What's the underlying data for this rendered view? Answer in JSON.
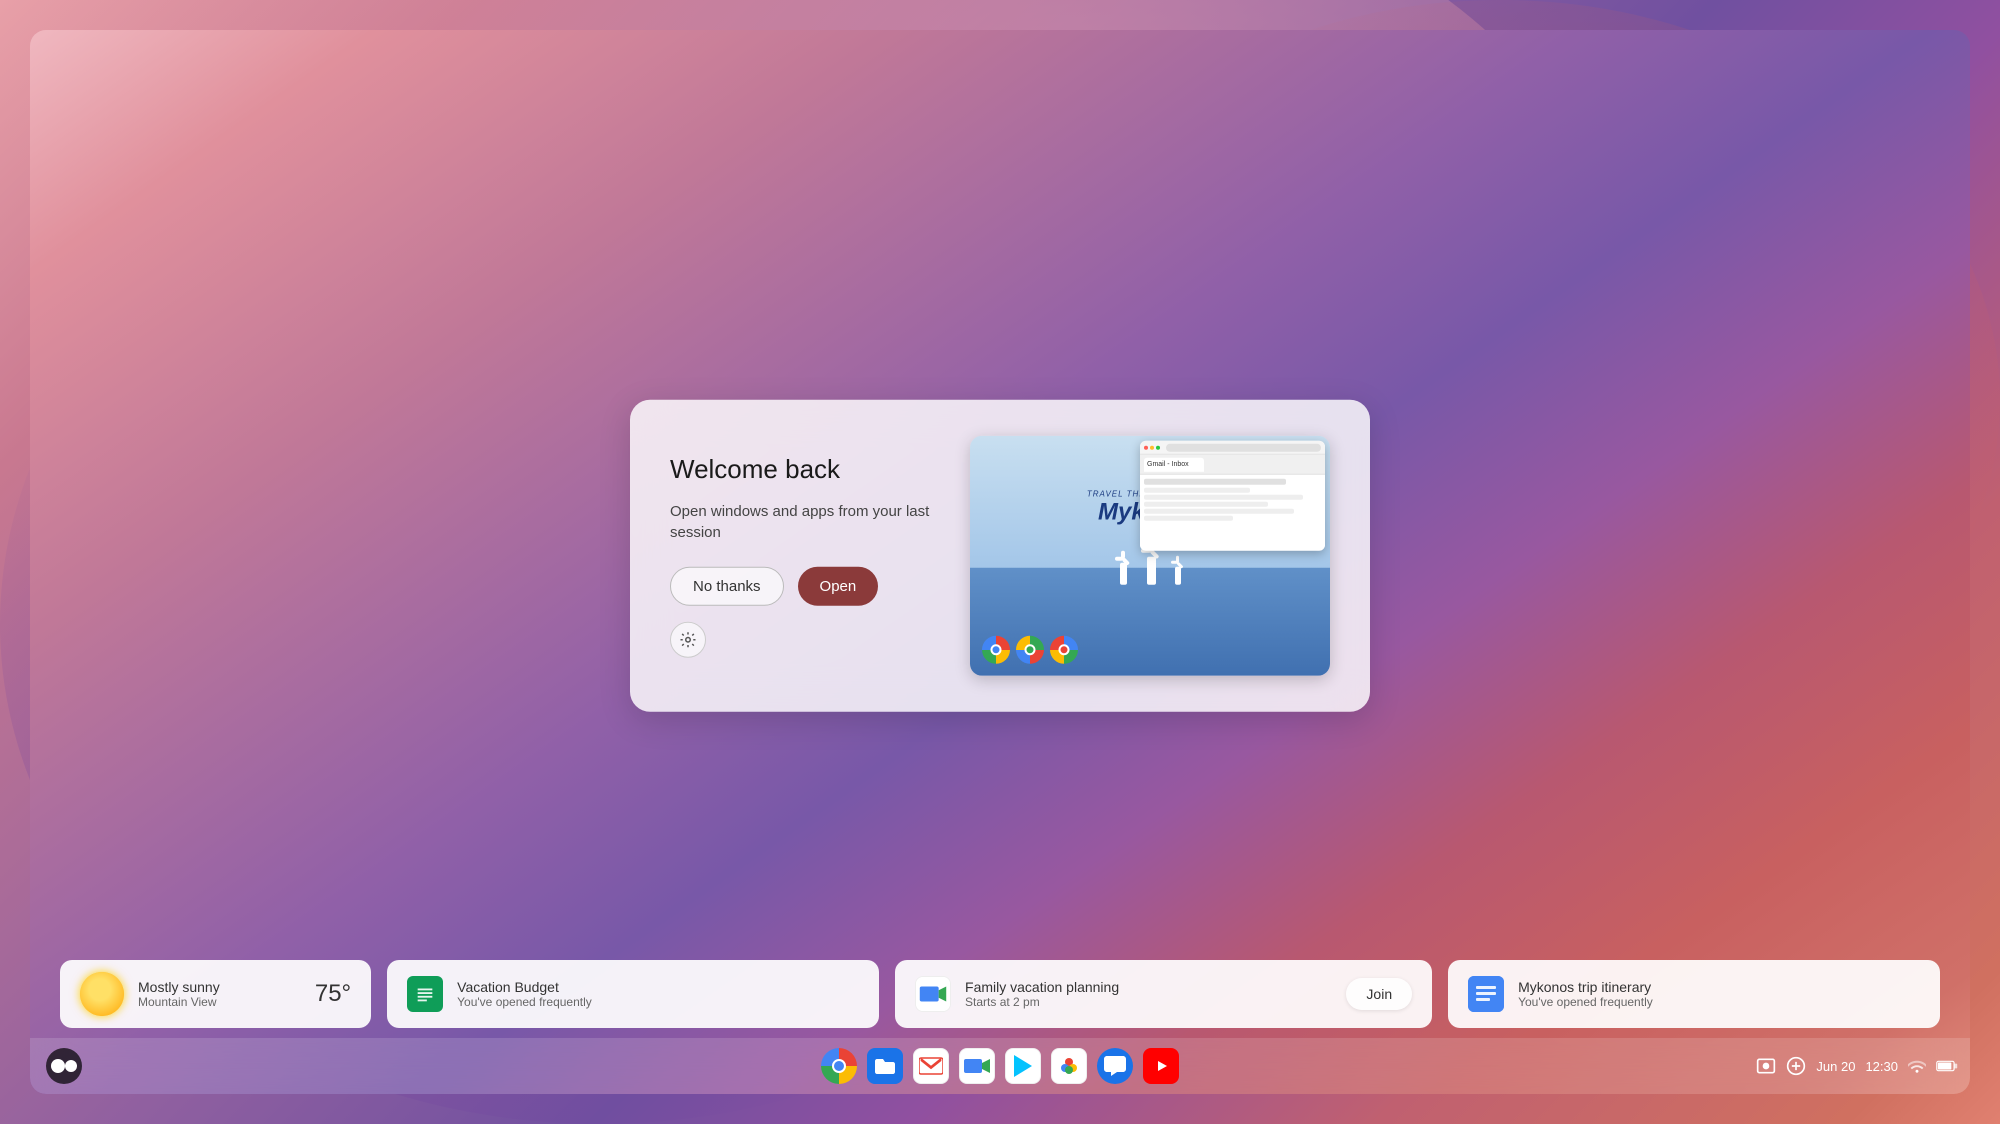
{
  "wallpaper": {
    "colors": [
      "#f0b0b8",
      "#c07898",
      "#9060a8",
      "#7050a8",
      "#c06070",
      "#d07060",
      "#e08070"
    ]
  },
  "dialog": {
    "title": "Welcome back",
    "description": "Open windows and apps from your last session",
    "no_thanks_label": "No thanks",
    "open_label": "Open",
    "settings_icon": "gear-icon",
    "preview_text": "Mykonos",
    "preview_subtitle": "Travel The World Blog"
  },
  "bottom_bar": {
    "weather": {
      "condition": "Mostly sunny",
      "location": "Mountain View",
      "temperature": "75°"
    },
    "vacation_budget": {
      "title": "Vacation Budget",
      "subtitle": "You've opened frequently",
      "icon": "sheets-icon"
    },
    "family_planning": {
      "title": "Family vacation planning",
      "subtitle": "Starts at 2 pm",
      "join_label": "Join",
      "icon": "meet-icon"
    },
    "mykonos_itinerary": {
      "title": "Mykonos trip itinerary",
      "subtitle": "You've opened frequently",
      "icon": "docs-icon"
    }
  },
  "shelf": {
    "apps": [
      {
        "name": "Chrome",
        "icon": "chrome-icon"
      },
      {
        "name": "Files",
        "icon": "files-icon"
      },
      {
        "name": "Gmail",
        "icon": "gmail-icon"
      },
      {
        "name": "Meet",
        "icon": "meet-icon"
      },
      {
        "name": "Play Store",
        "icon": "play-icon"
      },
      {
        "name": "Photos",
        "icon": "photos-icon"
      },
      {
        "name": "Chat",
        "icon": "chat-icon"
      },
      {
        "name": "YouTube",
        "icon": "youtube-icon"
      }
    ]
  },
  "system_tray": {
    "date": "Jun 20",
    "time": "12:30",
    "wifi_icon": "wifi-icon",
    "battery_icon": "battery-icon",
    "screenshot_icon": "screenshot-icon",
    "plus_icon": "plus-icon"
  },
  "launcher": {
    "icon": "launcher-icon"
  }
}
